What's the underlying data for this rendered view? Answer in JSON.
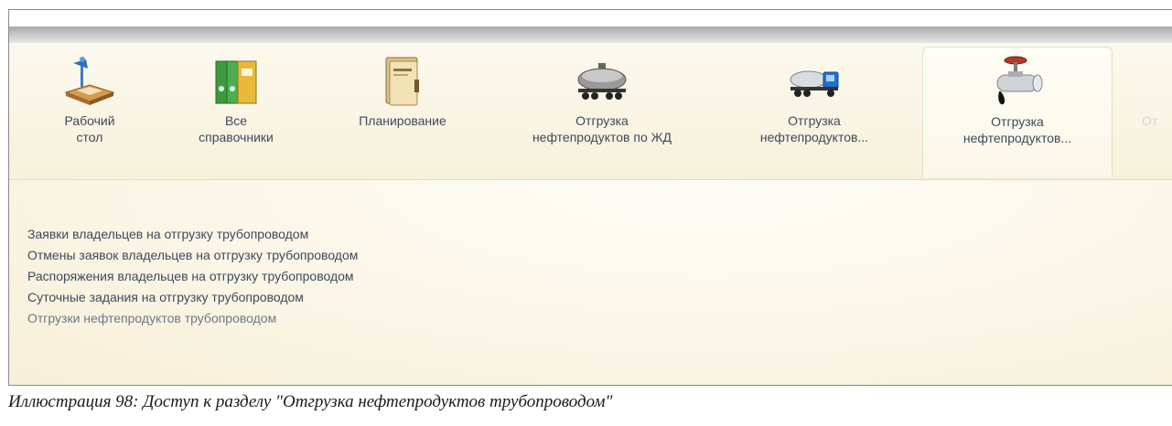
{
  "tabs": [
    {
      "line1": "Рабочий",
      "line2": "стол",
      "icon": "desk-lamp-icon"
    },
    {
      "line1": "Все",
      "line2": "справочники",
      "icon": "binders-icon"
    },
    {
      "line1": "Планирование",
      "line2": "",
      "icon": "folder-icon"
    },
    {
      "line1": "Отгрузка",
      "line2": "нефтепродуктов по ЖД",
      "icon": "rail-tank-car-icon"
    },
    {
      "line1": "Отгрузка",
      "line2": "нефтепродуктов...",
      "icon": "tanker-truck-icon"
    },
    {
      "line1": "Отгрузка",
      "line2": "нефтепродуктов...",
      "icon": "pipeline-valve-icon",
      "active": true
    },
    {
      "line1": "От",
      "line2": "",
      "icon": "partial-tab-icon"
    }
  ],
  "links": [
    "Заявки владельцев на отгрузку трубопроводом",
    "Отмены заявок владельцев на отгрузку трубопроводом",
    "Распоряжения владельцев на отгрузку трубопроводом",
    "Суточные задания на отгрузку трубопроводом",
    "Отгрузки нефтепродуктов трубопроводом"
  ],
  "caption": "Иллюстрация 98: Доступ к разделу \"Отгрузка нефтепродуктов трубопроводом\"",
  "colors": {
    "link": "#3c4a5c",
    "panel": "#f9f4e2",
    "accent": "#e7dfc4"
  }
}
